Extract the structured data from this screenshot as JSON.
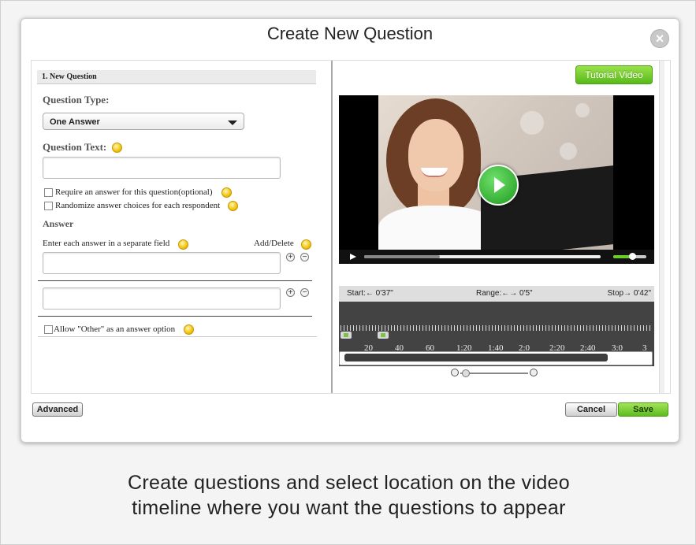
{
  "dialog": {
    "title": "Create New Question",
    "close_symbol": "×"
  },
  "form": {
    "section_header": "1. New Question",
    "question_type_label": "Question Type:",
    "question_type_value": "One Answer",
    "question_text_label": "Question Text:",
    "question_text_value": "",
    "require_answer_label": "Require an answer for this question(optional)",
    "randomize_label": "Randomize answer choices for each respondent",
    "answer_heading": "Answer",
    "answer_instruction": "Enter each answer in a separate field",
    "add_delete_label": "Add/Delete",
    "answers": [
      "",
      ""
    ],
    "plus_symbol": "+",
    "minus_symbol": "−",
    "allow_other_label": "Allow \"Other\" as an answer option"
  },
  "video_panel": {
    "tutorial_button": "Tutorial Video",
    "start_label": "Start:← 0'37\"",
    "range_label": "Range:←→ 0'5\"",
    "stop_label": "Stop→ 0'42\"",
    "timeline_labels": [
      "20",
      "40",
      "60",
      "1:20",
      "1:40",
      "2:0",
      "2:20",
      "2:40",
      "3:0",
      "3"
    ]
  },
  "footer": {
    "advanced_button": "Advanced",
    "cancel_button": "Cancel",
    "save_button": "Save"
  },
  "caption": {
    "line1": "Create questions and select location on the video",
    "line2": "timeline where you want the questions to appear"
  },
  "colors": {
    "accent_green": "#5cbc1f",
    "help_icon": "#f1c40f",
    "timeline_bg": "#434343"
  }
}
